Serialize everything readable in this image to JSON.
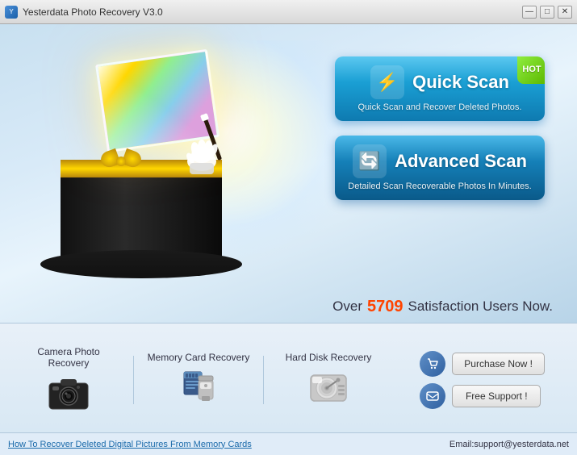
{
  "window": {
    "title": "Yesterdata Photo Recovery V3.0",
    "controls": {
      "minimize": "—",
      "maximize": "□",
      "close": "✕"
    }
  },
  "buttons": {
    "quick_scan_title": "Quick Scan",
    "quick_scan_subtitle": "Quick Scan and Recover Deleted Photos.",
    "advanced_scan_title": "Advanced Scan",
    "advanced_scan_subtitle": "Detailed Scan Recoverable Photos In Minutes.",
    "hot_badge": "HOT"
  },
  "stats": {
    "prefix": "Over",
    "number": "5709",
    "suffix": "Satisfaction Users Now."
  },
  "features": [
    {
      "label": "Camera Photo Recovery"
    },
    {
      "label": "Memory Card Recovery"
    },
    {
      "label": "Hard Disk Recovery"
    }
  ],
  "actions": {
    "purchase": "Purchase Now !",
    "support": "Free Support !"
  },
  "footer": {
    "link": "How To Recover Deleted Digital Pictures From Memory Cards",
    "email": "Email:support@yesterdata.net"
  }
}
